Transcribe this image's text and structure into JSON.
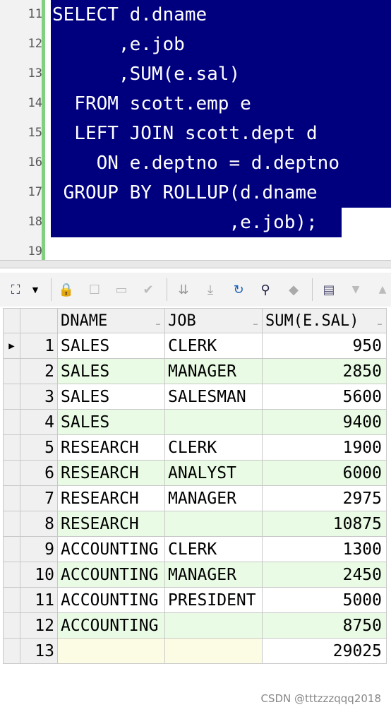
{
  "editor": {
    "lines": [
      {
        "num": "11",
        "code": "SELECT d.dname"
      },
      {
        "num": "12",
        "code": "      ,e.job"
      },
      {
        "num": "13",
        "code": "      ,SUM(e.sal)"
      },
      {
        "num": "14",
        "code": "  FROM scott.emp e"
      },
      {
        "num": "15",
        "code": "  LEFT JOIN scott.dept d"
      },
      {
        "num": "16",
        "code": "    ON e.deptno = d.deptno"
      },
      {
        "num": "17",
        "code": " GROUP BY ROLLUP(d.dname"
      },
      {
        "num": "18",
        "code": "                ,e.job);"
      },
      {
        "num": "19",
        "code": ""
      }
    ]
  },
  "toolbar": {
    "icons": [
      "select-mode-icon",
      "dropdown-icon",
      "lock-icon",
      "add-row-icon",
      "comment-icon",
      "check-icon",
      "next-record-icon",
      "last-record-icon",
      "refresh-icon",
      "find-icon",
      "clear-icon",
      "export-icon",
      "scroll-down-icon",
      "scroll-up-icon"
    ]
  },
  "grid": {
    "columns": [
      "DNAME",
      "JOB",
      "SUM(E.SAL)"
    ],
    "rows": [
      {
        "n": "1",
        "dname": "SALES",
        "job": "CLERK",
        "sum": "950"
      },
      {
        "n": "2",
        "dname": "SALES",
        "job": "MANAGER",
        "sum": "2850"
      },
      {
        "n": "3",
        "dname": "SALES",
        "job": "SALESMAN",
        "sum": "5600"
      },
      {
        "n": "4",
        "dname": "SALES",
        "job": "",
        "sum": "9400"
      },
      {
        "n": "5",
        "dname": "RESEARCH",
        "job": "CLERK",
        "sum": "1900"
      },
      {
        "n": "6",
        "dname": "RESEARCH",
        "job": "ANALYST",
        "sum": "6000"
      },
      {
        "n": "7",
        "dname": "RESEARCH",
        "job": "MANAGER",
        "sum": "2975"
      },
      {
        "n": "8",
        "dname": "RESEARCH",
        "job": "",
        "sum": "10875"
      },
      {
        "n": "9",
        "dname": "ACCOUNTING",
        "job": "CLERK",
        "sum": "1300"
      },
      {
        "n": "10",
        "dname": "ACCOUNTING",
        "job": "MANAGER",
        "sum": "2450"
      },
      {
        "n": "11",
        "dname": "ACCOUNTING",
        "job": "PRESIDENT",
        "sum": "5000"
      },
      {
        "n": "12",
        "dname": "ACCOUNTING",
        "job": "",
        "sum": "8750"
      },
      {
        "n": "13",
        "dname": "",
        "job": "",
        "sum": "29025"
      }
    ],
    "current_row_marker": "▶"
  },
  "watermark": "CSDN @tttzzzqqq2018",
  "colors": {
    "selection": "#00007f",
    "gutter_mark": "#80d080",
    "row_alt": "#e9fbe4",
    "empty_cell": "#fcfbe3"
  }
}
